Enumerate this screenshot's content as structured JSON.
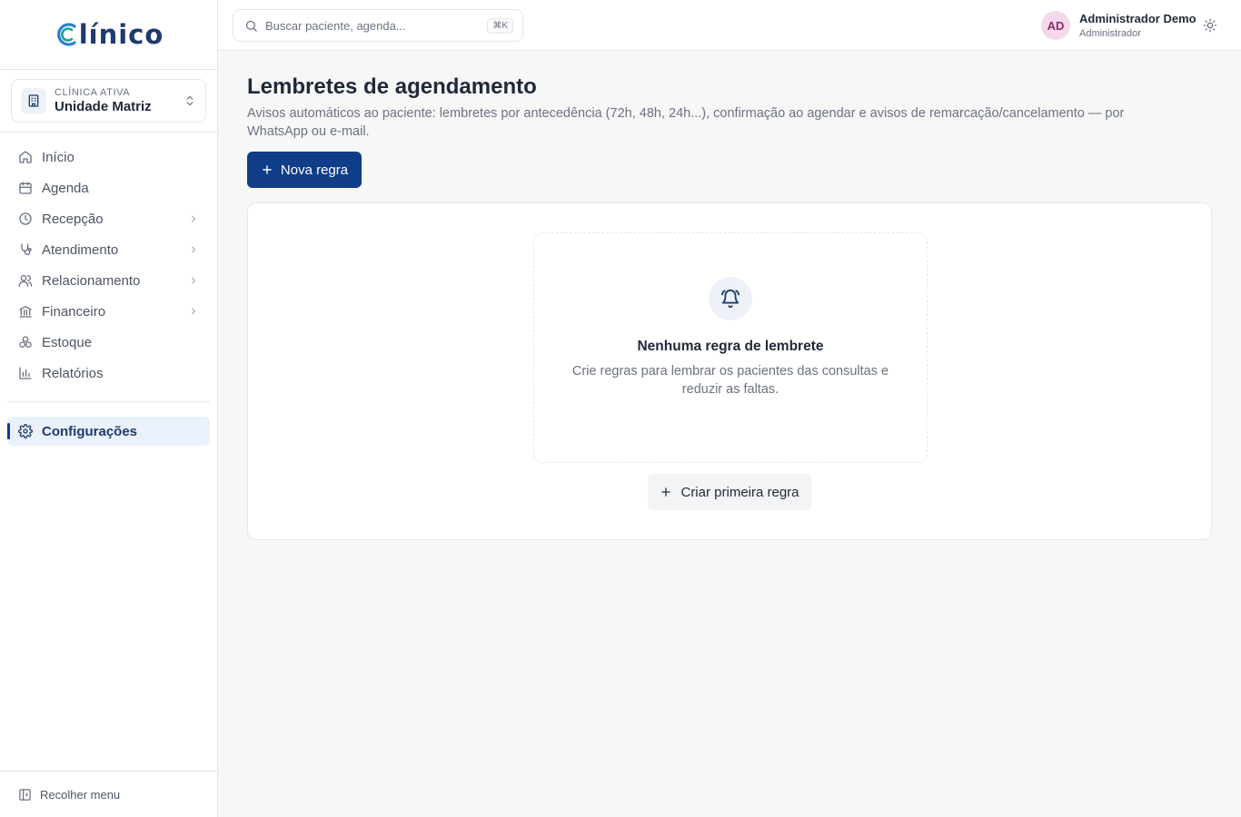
{
  "brand": {
    "logo_text": "Clínico",
    "accent_color": "#0f3d88",
    "logo_colors": [
      "#2a7fd4",
      "#1aa39a",
      "#1e3a6e"
    ]
  },
  "clinic": {
    "label": "CLÍNICA ATIVA",
    "name": "Unidade Matriz",
    "icon": "building-icon"
  },
  "sidebar": {
    "items": [
      {
        "label": "Início",
        "icon": "home-icon",
        "has_submenu": false
      },
      {
        "label": "Agenda",
        "icon": "calendar-icon",
        "has_submenu": false
      },
      {
        "label": "Recepção",
        "icon": "clock-icon",
        "has_submenu": true
      },
      {
        "label": "Atendimento",
        "icon": "stethoscope-icon",
        "has_submenu": true
      },
      {
        "label": "Relacionamento",
        "icon": "users-icon",
        "has_submenu": true
      },
      {
        "label": "Financeiro",
        "icon": "bank-icon",
        "has_submenu": true
      },
      {
        "label": "Estoque",
        "icon": "boxes-icon",
        "has_submenu": false
      },
      {
        "label": "Relatórios",
        "icon": "bar-chart-icon",
        "has_submenu": false
      }
    ],
    "settings": {
      "label": "Configurações",
      "icon": "gear-icon",
      "active": true
    },
    "collapse_label": "Recolher menu"
  },
  "header": {
    "search_placeholder": "Buscar paciente, agenda...",
    "search_shortcut": "⌘K",
    "user_initials": "AD",
    "user_name": "Administrador Demo",
    "user_role": "Administrador"
  },
  "main": {
    "title": "Lembretes de agendamento",
    "description": "Avisos automáticos ao paciente: lembretes por antecedência (72h, 48h, 24h...), confirmação ao agendar e avisos de remarcação/cancelamento — por WhatsApp ou e-mail.",
    "new_rule_label": "Nova regra",
    "empty_state": {
      "icon": "bell-icon",
      "title": "Nenhuma regra de lembrete",
      "description": "Crie regras para lembrar os pacientes das consultas e reduzir as faltas.",
      "cta_label": "Criar primeira regra"
    }
  }
}
